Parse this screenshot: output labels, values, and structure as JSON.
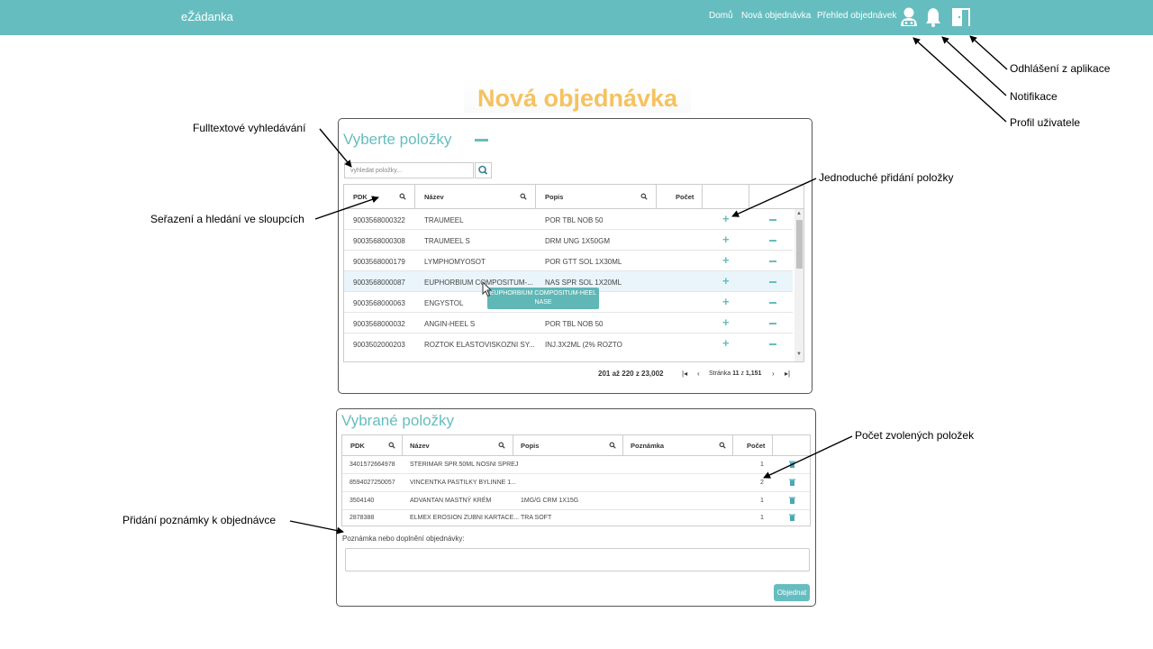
{
  "header": {
    "brand": "eŽádanka",
    "nav": [
      "Domů",
      "Nová objednávka",
      "Přehled objednávek"
    ],
    "icons": [
      "user-profile-icon",
      "bell-icon",
      "logout-icon"
    ],
    "bg_color": "#66bdbf"
  },
  "page_title": "Nová objednávka",
  "select_card": {
    "title": "Vyberte položky",
    "search_placeholder": "vyhledat položky...",
    "columns": [
      "PDK",
      "Název",
      "Popis",
      "Počet"
    ],
    "rows": [
      {
        "pdk": "9003568000322",
        "name": "TRAUMEEL",
        "desc": "POR TBL NOB 50"
      },
      {
        "pdk": "9003568000308",
        "name": "TRAUMEEL S",
        "desc": "DRM UNG 1X50GM"
      },
      {
        "pdk": "9003568000179",
        "name": "LYMPHOMYOSOT",
        "desc": "POR GTT SOL 1X30ML"
      },
      {
        "pdk": "9003568000087",
        "name": "EUPHORBIUM COMPOSITUM-...",
        "desc": "NAS SPR SOL 1X20ML"
      },
      {
        "pdk": "9003568000063",
        "name": "ENGYSTOL",
        "desc": ""
      },
      {
        "pdk": "9003568000032",
        "name": "ANGIN-HEEL S",
        "desc": "POR TBL NOB 50"
      },
      {
        "pdk": "9003502000203",
        "name": "ROZTOK ELASTOVISKOZNI SY...",
        "desc": "INJ.3X2ML (2% ROZTO"
      }
    ],
    "tooltip": [
      "EUPHORBIUM COMPOSITUM-HEEL",
      "NASE"
    ],
    "pager": {
      "range": "201 až 220 z 23,002",
      "page_label": "Stránka",
      "page": "11",
      "of": "z",
      "total_pages": "1,151"
    }
  },
  "selected_card": {
    "title": "Vybrané položky",
    "columns": [
      "PDK",
      "Název",
      "Popis",
      "Poznámka",
      "Počet"
    ],
    "rows": [
      {
        "pdk": "3401572664978",
        "name": "STERIMAR SPR.50ML NOSNI SPREJ",
        "desc": "",
        "count": "1"
      },
      {
        "pdk": "8594027250057",
        "name": "VINCENTKA PASTILKY BYLINNE 1...",
        "desc": "",
        "count": "2"
      },
      {
        "pdk": "3504140",
        "name": "ADVANTAN MASTNÝ KRÉM",
        "desc": "1MG/G CRM 1X15G",
        "count": "1"
      },
      {
        "pdk": "2878388",
        "name": "ELMEX EROSION ZUBNI KARTACE...",
        "desc": "TRA SOFT",
        "count": "1"
      }
    ],
    "note_label": "Poznámka nebo doplnění objednávky:",
    "order_button": "Objednat"
  },
  "annotations": {
    "logout": "Odhlášení z aplikace",
    "notifications": "Notifikace",
    "profile": "Profil uživatele",
    "fulltext": "Fulltextové vyhledávání",
    "sorting": "Seřazení a hledání ve sloupcích",
    "simple_add": "Jednoduché přidání položky",
    "count": "Počet zvolených položek",
    "note": "Přidání poznámky k objednávce"
  }
}
